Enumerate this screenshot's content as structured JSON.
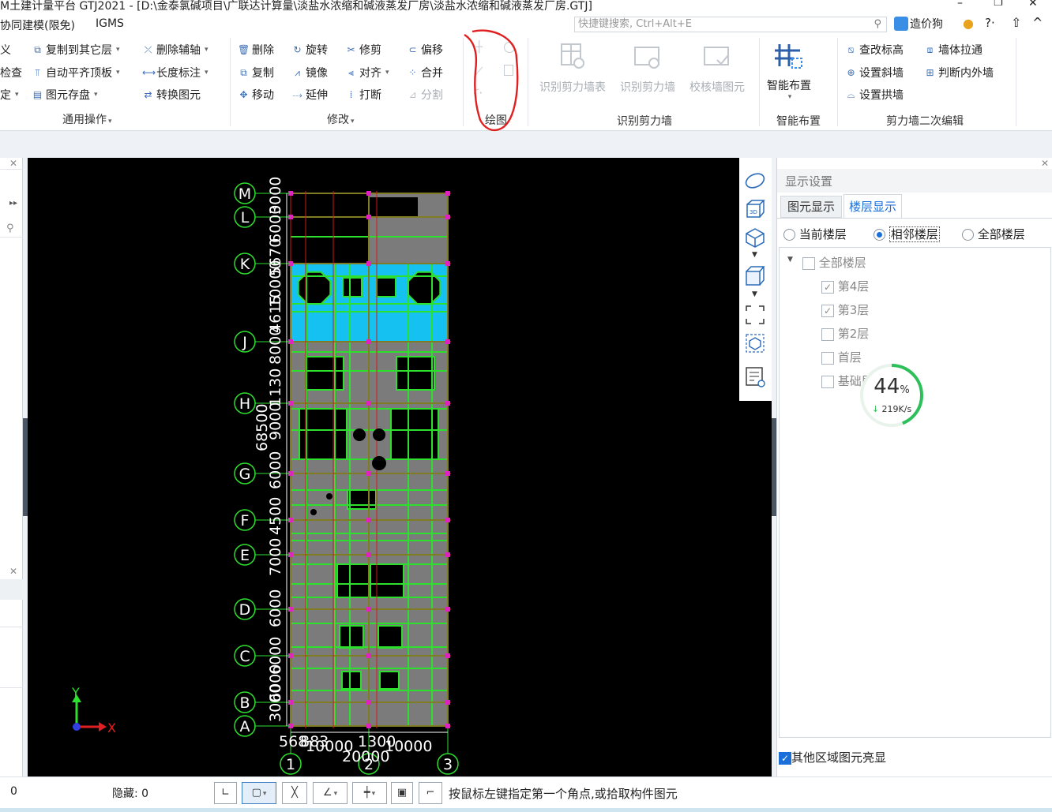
{
  "title": "M土建计量平台 GTJ2021 - [D:\\金泰氯碱项目\\广联达计算量\\淡盐水浓缩和碱液蒸发厂房\\淡盐水浓缩和碱液蒸发厂房.GTJ]",
  "window_controls": {
    "minimize": "–",
    "restore": "❐",
    "close": "✕"
  },
  "menu": {
    "items": [
      "协同建模(限免)",
      "IGMS"
    ]
  },
  "search": {
    "placeholder": "快捷键搜索, Ctrl+Alt+E"
  },
  "topright": {
    "user": "造价狗",
    "help": "?·",
    "shirt": "⇧",
    "collapse": "^"
  },
  "ribbon": {
    "groups": {
      "common": {
        "label": "通用操作",
        "left_cut": [
          "义",
          "检查",
          "定"
        ],
        "col1": [
          "复制到其它层",
          "自动平齐顶板",
          "图元存盘"
        ],
        "col2": [
          "删除辅轴",
          "长度标注",
          "转换图元"
        ]
      },
      "modify": {
        "label": "修改",
        "col1": [
          "删除",
          "复制",
          "移动"
        ],
        "col2": [
          "旋转",
          "镜像",
          "延伸"
        ],
        "col3": [
          "修剪",
          "对齐",
          "打断"
        ],
        "col4": [
          "偏移",
          "合并",
          "分割"
        ]
      },
      "draw": {
        "label": "绘图"
      },
      "identify": {
        "label": "识别剪力墙",
        "buttons": [
          "识别剪力墙表",
          "识别剪力墙",
          "校核墙图元"
        ]
      },
      "smart": {
        "label": "智能布置",
        "button": "智能布置"
      },
      "secondary": {
        "label": "剪力墙二次编辑",
        "col1": [
          "查改标高",
          "设置斜墙",
          "设置拱墙"
        ],
        "col2": [
          "墙体拉通",
          "判断内外墙"
        ]
      }
    }
  },
  "drawing": {
    "row_axes": [
      "M",
      "L",
      "K",
      "J",
      "H",
      "G",
      "F",
      "E",
      "D",
      "C",
      "B",
      "A"
    ],
    "col_axes": [
      "1",
      "2",
      "3"
    ],
    "vertical_dims": [
      "3000",
      "6000",
      "5670",
      "10000",
      "4615",
      "8000",
      "1130",
      "9000",
      "68500",
      "6000",
      "4500",
      "7000",
      "6000",
      "6000",
      "6000",
      "3000"
    ],
    "bottom_dims": [
      "568",
      "883",
      "10000",
      "1300",
      "10000",
      "20000"
    ],
    "axis_x": "X",
    "axis_y": "Y"
  },
  "display_panel": {
    "title": "显示设置",
    "tabs": [
      "图元显示",
      "楼层显示"
    ],
    "active_tab": "楼层显示",
    "radios": [
      "当前楼层",
      "相邻楼层",
      "全部楼层"
    ],
    "selected_radio": "相邻楼层",
    "tree_root": "全部楼层",
    "floors": [
      {
        "label": "第4层",
        "checked": true
      },
      {
        "label": "第3层",
        "checked": true
      },
      {
        "label": "第2层",
        "checked": false
      },
      {
        "label": "首层",
        "checked": false
      },
      {
        "label": "基础层",
        "checked": false
      }
    ],
    "footer": "其他区域图元亮显"
  },
  "speed_badge": {
    "percent": "44",
    "unit": "%",
    "rate": "219K/s",
    "progress": 0.44
  },
  "status": {
    "left_value": "0",
    "hidden_label": "隐藏: 0",
    "hint": "按鼠标左键指定第一个角点,或拾取构件图元"
  }
}
